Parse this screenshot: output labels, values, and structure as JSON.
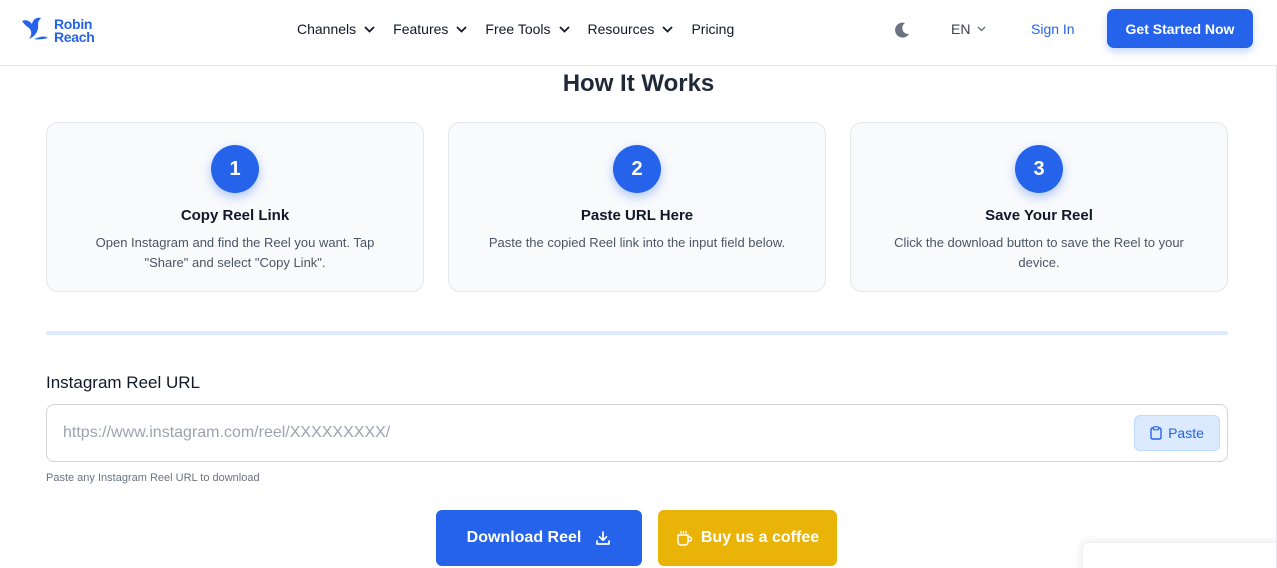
{
  "header": {
    "logo_line1": "Robin",
    "logo_line2": "Reach",
    "nav": [
      {
        "label": "Channels"
      },
      {
        "label": "Features"
      },
      {
        "label": "Free Tools"
      },
      {
        "label": "Resources"
      },
      {
        "label": "Pricing"
      }
    ],
    "language": "EN",
    "sign_in": "Sign In",
    "cta": "Get Started Now"
  },
  "how_it_works": {
    "title": "How It Works",
    "steps": [
      {
        "number": "1",
        "title": "Copy Reel Link",
        "description": "Open Instagram and find the Reel you want. Tap \"Share\" and select \"Copy Link\"."
      },
      {
        "number": "2",
        "title": "Paste URL Here",
        "description": "Paste the copied Reel link into the input field below."
      },
      {
        "number": "3",
        "title": "Save Your Reel",
        "description": "Click the download button to save the Reel to your device."
      }
    ]
  },
  "form": {
    "label": "Instagram Reel URL",
    "placeholder": "https://www.instagram.com/reel/XXXXXXXXX/",
    "value": "",
    "paste": "Paste",
    "hint": "Paste any Instagram Reel URL to download",
    "download": "Download Reel",
    "coffee": "Buy us a coffee"
  },
  "colors": {
    "primary": "#2563eb",
    "coffee": "#eab308",
    "card_bg": "#f8fafc",
    "divider": "#dbeafe"
  },
  "icons": {
    "logo": "bird-icon",
    "nav_chevron": "chevron-down-icon",
    "theme": "moon-icon",
    "paste": "clipboard-icon",
    "download": "download-icon",
    "coffee": "coffee-cup-icon"
  }
}
